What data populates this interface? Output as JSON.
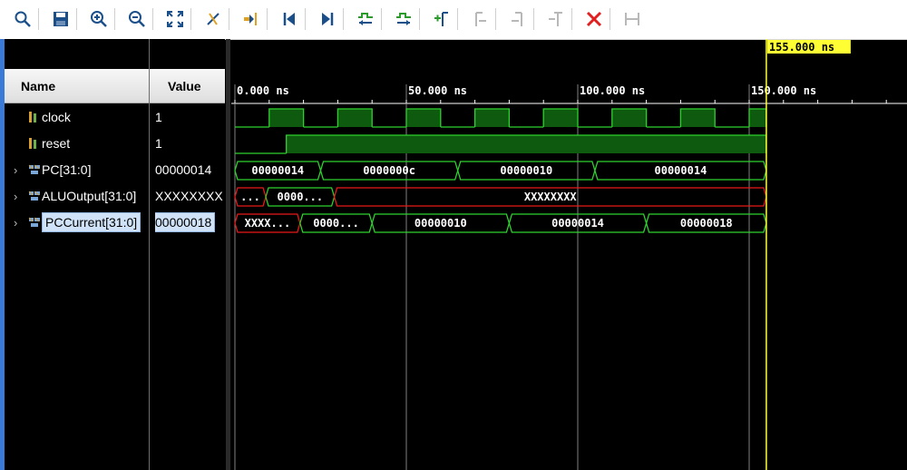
{
  "toolbar": {
    "buttons": [
      {
        "name": "search-button",
        "icon": "search-icon"
      },
      {
        "name": "save-button",
        "icon": "save-icon"
      },
      {
        "name": "zoom-in-button",
        "icon": "zoom-in-icon"
      },
      {
        "name": "zoom-out-button",
        "icon": "zoom-out-icon"
      },
      {
        "name": "zoom-fit-button",
        "icon": "zoom-fit-icon"
      },
      {
        "name": "cursor-to-zero-button",
        "icon": "cursor-icon"
      },
      {
        "name": "go-to-cursor-button",
        "icon": "go-to-cursor-icon"
      },
      {
        "name": "go-to-time-0-button",
        "icon": "first-icon"
      },
      {
        "name": "go-to-last-time-button",
        "icon": "last-icon"
      },
      {
        "name": "previous-transition-button",
        "icon": "previous-transition-icon"
      },
      {
        "name": "next-transition-button",
        "icon": "next-transition-icon"
      },
      {
        "name": "add-marker-button",
        "icon": "add-marker-icon"
      },
      {
        "name": "previous-marker-button",
        "icon": "previous-marker-icon"
      },
      {
        "name": "next-marker-button",
        "icon": "next-marker-icon"
      },
      {
        "name": "delete-marker-button",
        "icon": "delete-marker-icon"
      },
      {
        "name": "delete-all-button",
        "icon": "delete-icon"
      },
      {
        "name": "swap-cursors-button",
        "icon": "swap-icon"
      }
    ]
  },
  "columns": {
    "name": "Name",
    "value": "Value"
  },
  "cursor": {
    "label": "155.000 ns",
    "time": 155
  },
  "timeline": {
    "ticks": [
      {
        "t": 0,
        "label": "0.000 ns"
      },
      {
        "t": 50,
        "label": "50.000 ns"
      },
      {
        "t": 100,
        "label": "100.000 ns"
      },
      {
        "t": 150,
        "label": "150.000 ns"
      }
    ],
    "unit": "ns"
  },
  "signals": [
    {
      "name": "clock",
      "value": "1",
      "kind": "bit",
      "expandable": false,
      "selected": false,
      "wave": [
        [
          0,
          10,
          0
        ],
        [
          10,
          20,
          1
        ],
        [
          20,
          30,
          0
        ],
        [
          30,
          40,
          1
        ],
        [
          40,
          50,
          0
        ],
        [
          50,
          60,
          1
        ],
        [
          60,
          70,
          0
        ],
        [
          70,
          80,
          1
        ],
        [
          80,
          90,
          0
        ],
        [
          90,
          100,
          1
        ],
        [
          100,
          110,
          0
        ],
        [
          110,
          120,
          1
        ],
        [
          120,
          130,
          0
        ],
        [
          130,
          140,
          1
        ],
        [
          140,
          150,
          0
        ],
        [
          150,
          155,
          1
        ]
      ]
    },
    {
      "name": "reset",
      "value": "1",
      "kind": "bit",
      "expandable": false,
      "selected": false,
      "wave": [
        [
          0,
          15,
          0
        ],
        [
          15,
          155,
          1
        ]
      ]
    },
    {
      "name": "PC[31:0]",
      "value": "00000014",
      "kind": "bus",
      "expandable": true,
      "selected": false,
      "wave": [
        [
          0,
          25,
          "00000014"
        ],
        [
          25,
          65,
          "0000000c"
        ],
        [
          65,
          105,
          "00000010"
        ],
        [
          105,
          155,
          "00000014"
        ]
      ]
    },
    {
      "name": "ALUOutput[31:0]",
      "value": "XXXXXXXX",
      "kind": "bus",
      "expandable": true,
      "selected": false,
      "wave": [
        [
          0,
          9,
          "...",
          "x"
        ],
        [
          9,
          29,
          "0000...",
          "ok"
        ],
        [
          29,
          155,
          "XXXXXXXX",
          "x"
        ]
      ]
    },
    {
      "name": "PCCurrent[31:0]",
      "value": "00000018",
      "kind": "bus",
      "expandable": true,
      "selected": true,
      "wave": [
        [
          0,
          19,
          "XXXX...",
          "x"
        ],
        [
          19,
          40,
          "0000...",
          "ok"
        ],
        [
          40,
          80,
          "00000010",
          "ok"
        ],
        [
          80,
          120,
          "00000014",
          "ok"
        ],
        [
          120,
          155,
          "00000018",
          "ok"
        ]
      ]
    }
  ],
  "colors": {
    "wave": "#2fd12f",
    "wave_fill": "#0e5a0e",
    "x_value": "#e81818",
    "cursor": "#ffff33",
    "grid": "#808080"
  }
}
